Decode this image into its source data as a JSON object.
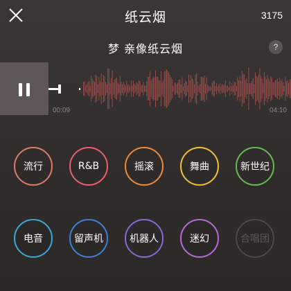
{
  "header": {
    "title": "纸云烟",
    "count": "3175",
    "close_icon": "close-icon"
  },
  "song": {
    "title": "梦 亲像纸云烟",
    "help_label": "?"
  },
  "player": {
    "state": "playing",
    "current_time": "00:09",
    "total_time": "04:10",
    "progress": 0.036,
    "waveform_color": "#a0504d"
  },
  "genres": [
    {
      "label": "流行",
      "color": "#e07a6a",
      "enabled": true
    },
    {
      "label": "R&B",
      "color": "#ef5f6f",
      "enabled": true
    },
    {
      "label": "摇滚",
      "color": "#f08a3c",
      "enabled": true
    },
    {
      "label": "舞曲",
      "color": "#f2c233",
      "enabled": true
    },
    {
      "label": "新世纪",
      "color": "#66bb55",
      "enabled": true
    },
    {
      "label": "电音",
      "color": "#3fa7d6",
      "enabled": true
    },
    {
      "label": "留声机",
      "color": "#3f7fd8",
      "enabled": true
    },
    {
      "label": "机器人",
      "color": "#8b67d6",
      "enabled": true
    },
    {
      "label": "迷幻",
      "color": "#b86bd8",
      "enabled": true
    },
    {
      "label": "合唱团",
      "color": "#4b4747",
      "enabled": false
    }
  ]
}
